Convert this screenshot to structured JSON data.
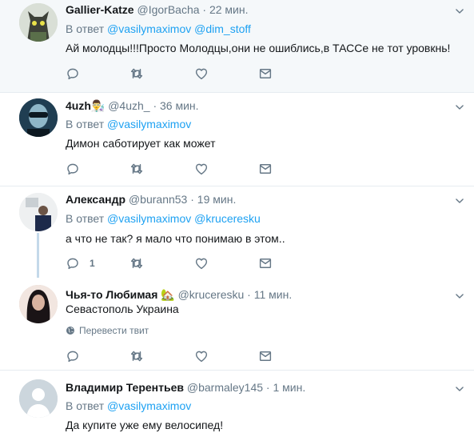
{
  "tweets": [
    {
      "name": "Gallier-Katze",
      "handle": "@IgorBacha",
      "time": "· 22 мин.",
      "reply_prefix": "В ответ",
      "mentions": [
        "@vasilymaximov",
        "@dim_stoff"
      ],
      "text": "Ай молодцы!!!Просто Молодцы,они не ошиблись,в ТАССе не тот уровкнь!",
      "reply_count": "",
      "highlighted": true
    },
    {
      "name": "4uzh",
      "name_emoji": "👨‍🔬",
      "handle": "@4uzh_",
      "time": "· 36 мин.",
      "reply_prefix": "В ответ",
      "mentions": [
        "@vasilymaximov"
      ],
      "text": "Димон саботирует как может",
      "reply_count": ""
    },
    {
      "name": "Александр",
      "handle": "@burann53",
      "time": "· 19 мин.",
      "reply_prefix": "В ответ",
      "mentions": [
        "@vasilymaximov",
        "@kruceresku"
      ],
      "text": "а  что не так? я   мало  что понимаю в этом..",
      "reply_count": "1"
    },
    {
      "name": "Чья-то Любимая",
      "name_emoji": "🏡",
      "handle": "@kruceresku",
      "time": "· 11 мин.",
      "text": "Севастополь Украина",
      "translate": "Перевести твит",
      "reply_count": ""
    },
    {
      "name": "Владимир Терентьев",
      "handle": "@barmaley145",
      "time": "· 1 мин.",
      "reply_prefix": "В ответ",
      "mentions": [
        "@vasilymaximov"
      ],
      "text": "Да купите уже ему велосипед!"
    }
  ],
  "colors": {
    "accent": "#1da1f2",
    "muted": "#657786",
    "separator": "#e6ecf0",
    "highlight_bg": "#f5f8fa",
    "thread_line": "#c4d9ea"
  }
}
